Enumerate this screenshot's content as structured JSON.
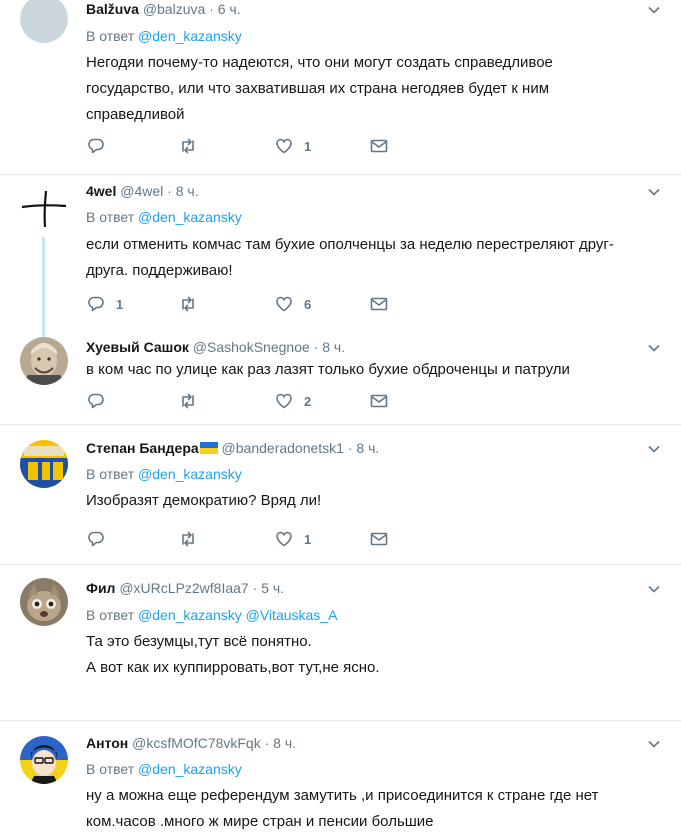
{
  "reply_prefix": "В ответ",
  "tweets": [
    {
      "name": "Balžuva",
      "handle": "@balzuva",
      "time": "6 ч.",
      "reply_to": [
        "@den_kazansky"
      ],
      "lines": [
        "Негодяи почему-то надеются, что они могут создать справедливое",
        "государство, или что захватившая их страна негодяев будет к ним",
        "справедливой"
      ],
      "replies": "",
      "retweets": "",
      "likes": "1"
    },
    {
      "name": "4wel",
      "handle": "@4wel",
      "time": "8 ч.",
      "reply_to": [
        "@den_kazansky"
      ],
      "lines": [
        "если отменить комчас там бухие ополченцы за неделю перестреляют друг-",
        "друга. поддерживаю!"
      ],
      "replies": "1",
      "retweets": "",
      "likes": "6"
    },
    {
      "name": "Хуевый Сашок",
      "handle": "@SashokSnegnoe",
      "time": "8 ч.",
      "reply_to": [],
      "lines": [
        "в ком час по улице как раз лазят только бухие обдроченцы и патрули"
      ],
      "replies": "",
      "retweets": "",
      "likes": "2"
    },
    {
      "name": "Степан Бандера",
      "handle": "@banderadonetsk1",
      "time": "8 ч.",
      "reply_to": [
        "@den_kazansky"
      ],
      "lines": [
        "Изобразят демократию? Вряд ли!"
      ],
      "replies": "",
      "retweets": "",
      "likes": "1"
    },
    {
      "name": "Фил",
      "handle": "@xURcLPz2wf8Iaa7",
      "time": "5 ч.",
      "reply_to": [
        "@den_kazansky",
        "@Vitauskas_A"
      ],
      "lines": [
        "Та это безумцы,тут всё понятно.",
        "А вот как их куппирровать,вот тут,не ясно."
      ],
      "replies": "",
      "retweets": "",
      "likes": ""
    },
    {
      "name": "Антон",
      "handle": "@kcsfMOfC78vkFqk",
      "time": "8 ч.",
      "reply_to": [
        "@den_kazansky"
      ],
      "lines": [
        "ну а можна еще референдум замутить ,и присоединится к стране где нет",
        "ком.часов .много ж мире стран и пенсии большие"
      ],
      "replies": "",
      "retweets": "",
      "likes": ""
    }
  ],
  "icons": {
    "reply": "reply-icon",
    "retweet": "retweet-icon",
    "like": "heart-icon",
    "dm": "envelope-icon",
    "more": "chevron-down-icon"
  },
  "colors": {
    "link": "#1da1f2",
    "muted": "#657786",
    "thread_line": "#c4e4f7"
  }
}
